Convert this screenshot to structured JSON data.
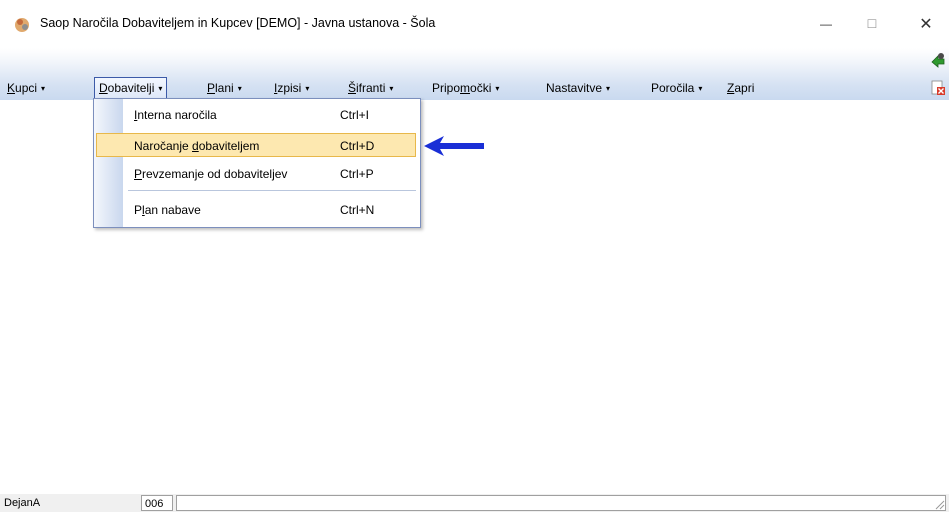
{
  "window": {
    "title": "Saop Naročila Dobaviteljem in Kupcev [DEMO] - Javna ustanova - Šola",
    "minimize_glyph": "—",
    "maximize_glyph": "☐",
    "close_glyph": "✕"
  },
  "menubar": {
    "items": [
      {
        "pre": "",
        "key": "K",
        "post": "upci",
        "arrow": "▾"
      },
      {
        "pre": "",
        "key": "D",
        "post": "obavitelji",
        "arrow": "▾"
      },
      {
        "pre": "",
        "key": "P",
        "post": "lani",
        "arrow": "▾"
      },
      {
        "pre": "",
        "key": "I",
        "post": "zpisi",
        "arrow": "▾"
      },
      {
        "pre": "",
        "key": "Š",
        "post": "ifranti",
        "arrow": "▾"
      },
      {
        "pre": "Pripo",
        "key": "m",
        "post": "očki",
        "arrow": "▾"
      },
      {
        "pre": "Nastavitve",
        "key": "",
        "post": "",
        "arrow": "▾"
      },
      {
        "pre": "Poročila",
        "key": "",
        "post": "",
        "arrow": "▾"
      },
      {
        "pre": "",
        "key": "Z",
        "post": "apri",
        "arrow": ""
      }
    ],
    "active_menu": "Dobavitelji"
  },
  "dropdown": {
    "items": [
      {
        "pre": "",
        "key": "I",
        "post": "nterna naročila",
        "shortcut": "Ctrl+I"
      },
      {
        "pre": "Naročanje ",
        "key": "d",
        "post": "obaviteljem",
        "shortcut": "Ctrl+D",
        "highlighted": true
      },
      {
        "pre": "",
        "key": "P",
        "post": "revzemanje od dobaviteljev",
        "shortcut": "Ctrl+P"
      },
      {
        "pre": "P",
        "key": "l",
        "post": "an nabave",
        "shortcut": "Ctrl+N"
      }
    ]
  },
  "icons": [
    "app-icon",
    "green-arrow-icon",
    "red-close-doc-icon",
    "blue-arrow-annotation-icon",
    "size-grip-icon"
  ],
  "statusbar": {
    "user": "DejanA",
    "code": "006",
    "message": ""
  },
  "colors": {
    "menubar_gradient_end": "#c9d9ef",
    "highlight_bg": "#fde8b0",
    "highlight_border": "#e8b84a",
    "annotation_arrow": "#1a2fd6"
  }
}
